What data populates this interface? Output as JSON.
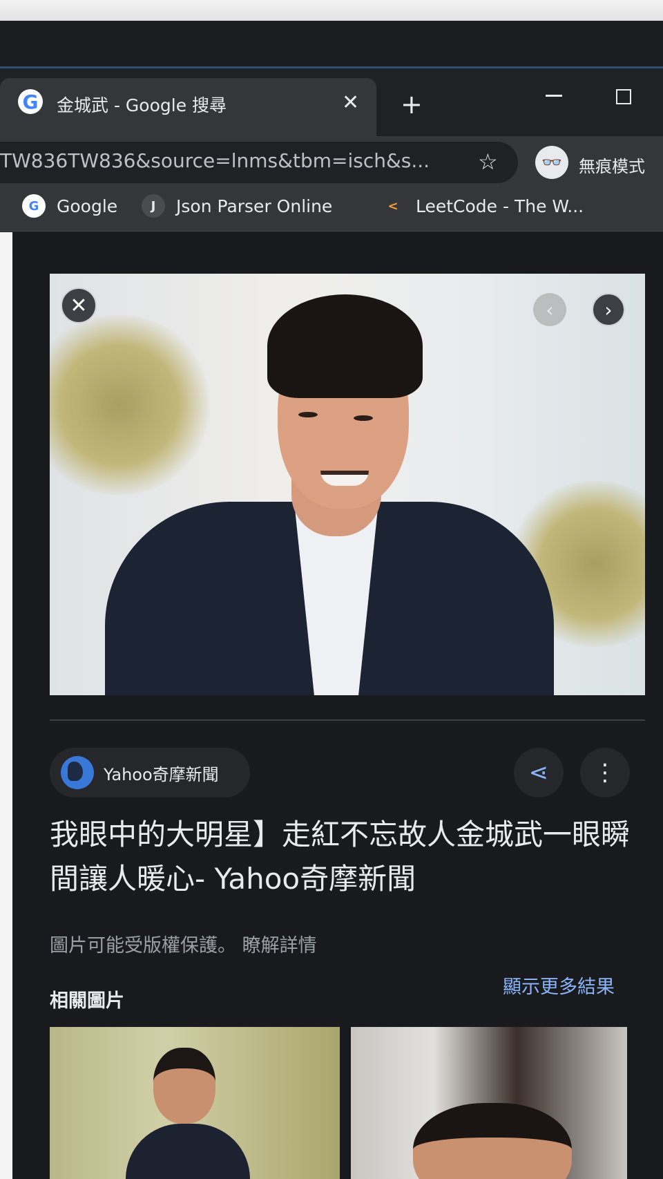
{
  "browser": {
    "tab_favicon": "G",
    "tab_title": "金城武 - Google 搜尋",
    "tab_close": "✕",
    "new_tab": "+",
    "url": "TW836TW836&source=lnms&tbm=isch&s...",
    "star_icon": "☆",
    "incognito_icon": "👓",
    "incognito_label": "無痕模式"
  },
  "bookmarks": [
    {
      "label": "Google",
      "icon": "G"
    },
    {
      "label": "Json Parser Online",
      "icon": "J"
    },
    {
      "label": "LeetCode - The W...",
      "icon": "<"
    }
  ],
  "viewer": {
    "close": "✕",
    "prev": "‹",
    "next": "›",
    "source": "Yahoo奇摩新聞",
    "share_icon": "⋖",
    "more_icon": "⋮",
    "title": "我眼中的大明星】走紅不忘故人金城武一眼瞬間讓人暖心- Yahoo奇摩新聞",
    "copyright": "圖片可能受版權保護。",
    "learn_more": "瞭解詳情",
    "related_label": "相關圖片",
    "more_results": "顯示更多結果"
  },
  "colors": {
    "accent": "#8ab4f8",
    "background": "#181a1d",
    "tab": "#35363a"
  }
}
